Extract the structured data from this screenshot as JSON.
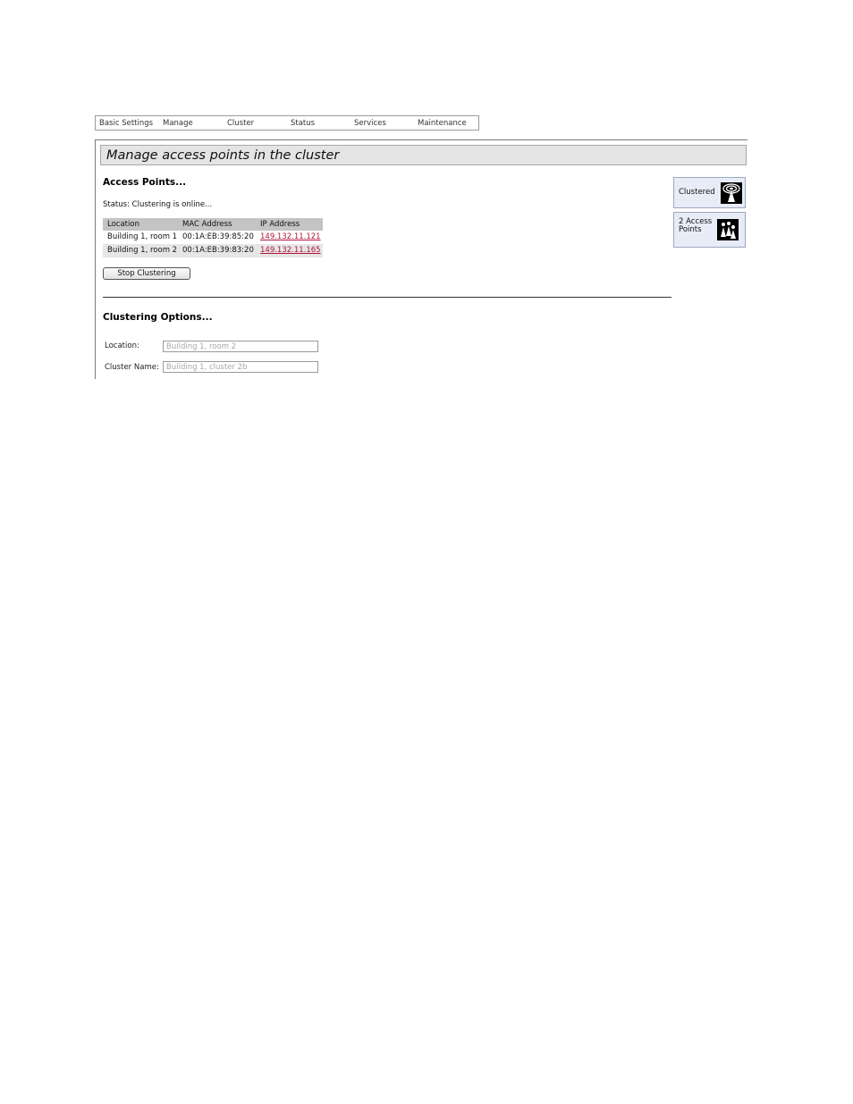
{
  "nav": {
    "items": [
      "Basic Settings",
      "Manage",
      "Cluster",
      "Status",
      "Services",
      "Maintenance"
    ]
  },
  "page": {
    "title": "Manage access points in the cluster"
  },
  "access_points": {
    "heading": "Access Points...",
    "status_text": "Status: Clustering is online...",
    "columns": [
      "Location",
      "MAC Address",
      "IP Address"
    ],
    "rows": [
      {
        "location": "Building 1, room 1",
        "mac": "00:1A:EB:39:85:20",
        "ip": "149.132.11.121"
      },
      {
        "location": "Building 1, room 2",
        "mac": "00:1A:EB:39:83:20",
        "ip": "149.132.11.165"
      }
    ],
    "stop_button": "Stop Clustering"
  },
  "clustering_options": {
    "heading": "Clustering Options...",
    "location_label": "Location:",
    "location_value": "Building 1, room 2",
    "cluster_name_label": "Cluster Name:",
    "cluster_name_value": "Building 1, cluster 2b"
  },
  "sidebar": {
    "clustered_label": "Clustered",
    "clustered_icon": "cluster-broadcast-icon",
    "ap_count_label": "2 Access Points",
    "ap_count_icon": "access-points-group-icon"
  },
  "colors": {
    "link": "#b0143c",
    "title_bar": "#e4e4e4",
    "table_header": "#c4c4c4",
    "status_box": "#e8ecf6"
  }
}
